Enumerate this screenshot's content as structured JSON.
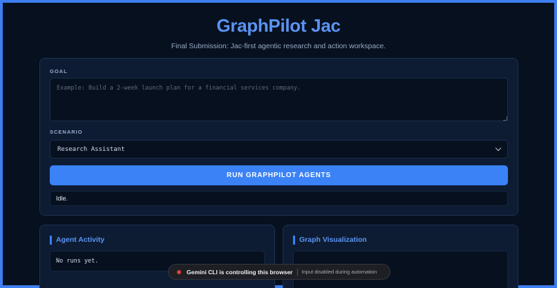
{
  "header": {
    "title": "GraphPilot Jac",
    "subtitle": "Final Submission: Jac-first agentic research and action workspace."
  },
  "form": {
    "goal_label": "GOAL",
    "goal_placeholder": "Example: Build a 2-week launch plan for a financial services company.",
    "goal_value": "",
    "scenario_label": "SCENARIO",
    "scenario_selected": "Research Assistant",
    "run_button_label": "RUN GRAPHPILOT AGENTS",
    "status_text": "Idle."
  },
  "agent_activity": {
    "heading": "Agent Activity",
    "empty_text": "No runs yet."
  },
  "graph": {
    "heading": "Graph Visualization"
  },
  "banner": {
    "main_text": "Gemini CLI is controlling this browser",
    "sub_text": "Input disabled during automation"
  },
  "colors": {
    "accent": "#3a82f6",
    "title": "#5b93f2",
    "background": "#06101f",
    "panel": "#0d1c33",
    "frame": "#3d7ef0",
    "banner_dot": "#d9423a"
  },
  "icons": {
    "select_chevron": "chevron-down-icon",
    "banner_indicator": "recording-dot-icon"
  }
}
